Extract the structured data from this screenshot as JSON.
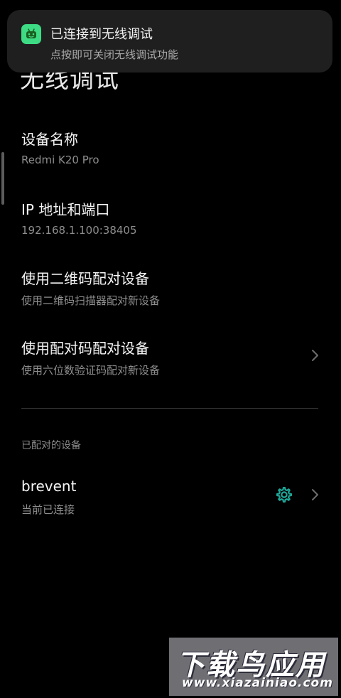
{
  "notification": {
    "icon": "android-icon",
    "title": "已连接到无线调试",
    "subtitle": "点按即可关闭无线调试功能"
  },
  "page": {
    "title": "无线调试"
  },
  "items": [
    {
      "title": "设备名称",
      "subtitle": "Redmi K20 Pro"
    },
    {
      "title": "IP 地址和端口",
      "subtitle": "192.168.1.100:38405"
    },
    {
      "title": "使用二维码配对设备",
      "subtitle": "使用二维码扫描器配对新设备"
    },
    {
      "title": "使用配对码配对设备",
      "subtitle": "使用六位数验证码配对新设备"
    }
  ],
  "paired_section": {
    "header": "已配对的设备",
    "devices": [
      {
        "name": "brevent",
        "status": "当前已连接"
      }
    ]
  },
  "watermark": {
    "main": "下载鸟应用",
    "url": "www.xiazainiao.com"
  },
  "colors": {
    "background": "#000000",
    "accent": "#3ddc84",
    "gear": "#1fa89a"
  }
}
